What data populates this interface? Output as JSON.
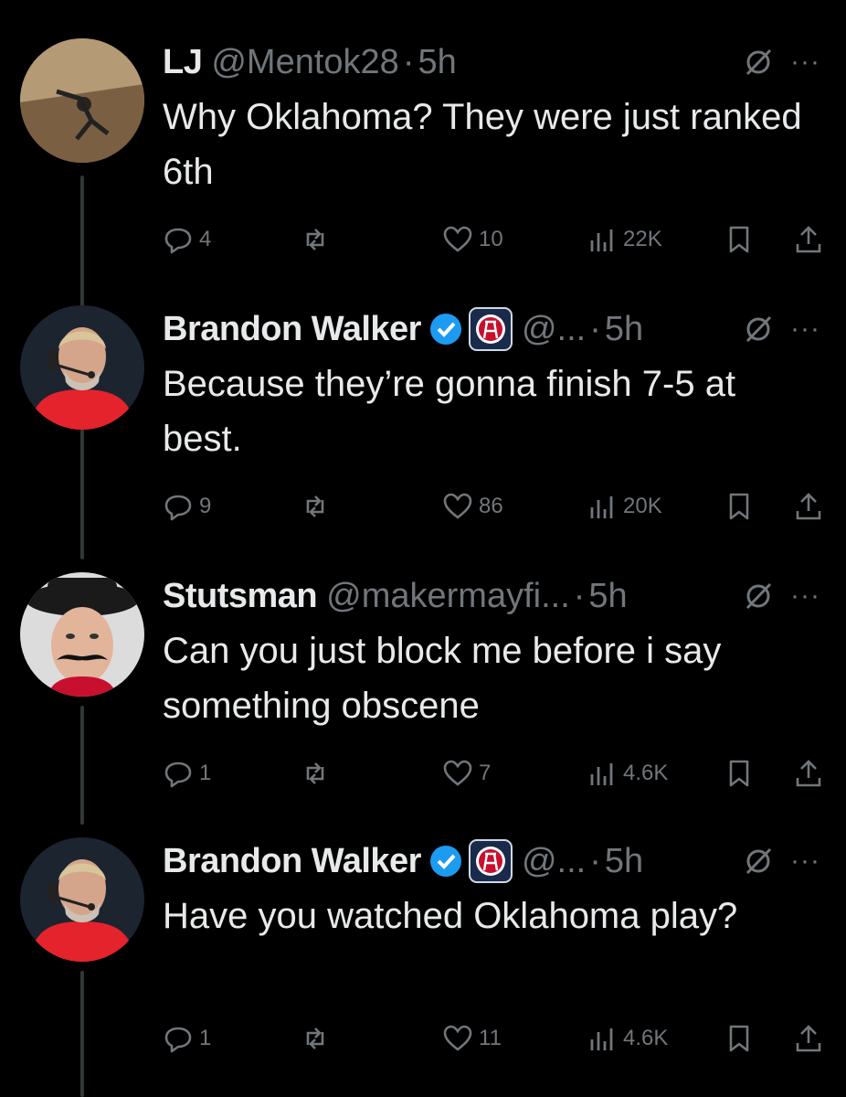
{
  "tweets": [
    {
      "name": "LJ",
      "handle": "@Mentok28",
      "dot": "·",
      "time": "5h",
      "text": "Why Oklahoma? They were just ranked 6th",
      "verified": false,
      "replies": "4",
      "likes": "10",
      "views": "22K",
      "avatar": "break-dancer-photo"
    },
    {
      "name": "Brandon Walker",
      "handle": "@...",
      "dot": "·",
      "time": "5h",
      "text": "Because they’re gonna finish 7-5 at best.",
      "verified": true,
      "replies": "9",
      "likes": "86",
      "views": "20K",
      "avatar": "man-with-headset-photo"
    },
    {
      "name": "Stutsman",
      "handle": "@makermayfi...",
      "dot": "·",
      "time": "5h",
      "text": "Can you just block me before i say something obscene",
      "verified": false,
      "replies": "1",
      "likes": "7",
      "views": "4.6K",
      "avatar": "man-with-hat-and-mustache-photo"
    },
    {
      "name": "Brandon Walker",
      "handle": "@...",
      "dot": "·",
      "time": "5h",
      "text": "Have you watched Oklahoma play?",
      "verified": true,
      "replies": "1",
      "likes": "11",
      "views": "4.6K",
      "avatar": "man-with-headset-photo"
    }
  ],
  "more_label": "···",
  "colors": {
    "background": "#000000",
    "text": "#e7e9ea",
    "muted": "#71767b",
    "verified": "#1d9bf0"
  }
}
